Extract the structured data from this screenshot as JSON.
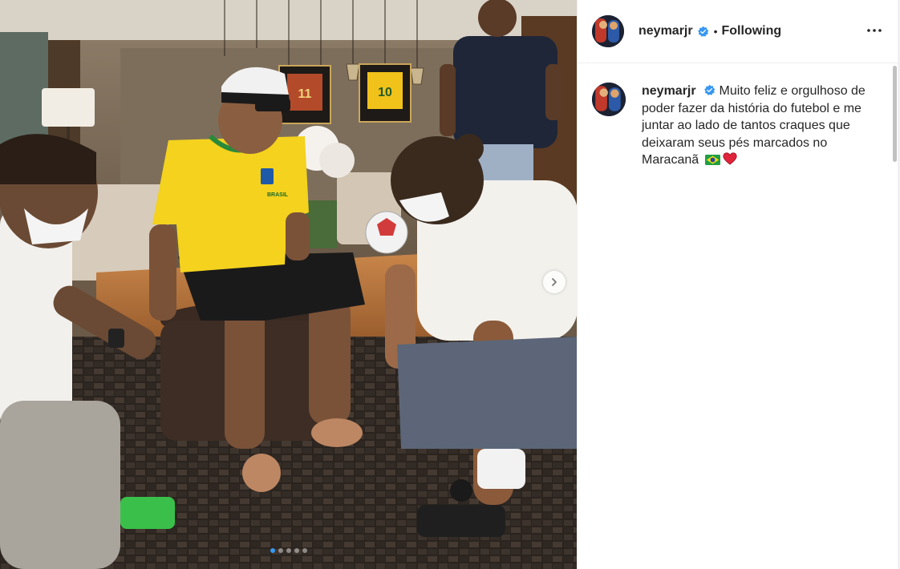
{
  "post": {
    "username": "neymarjr",
    "separator": "•",
    "follow_status": "Following",
    "caption_username": "neymarjr",
    "caption_text": "Muito feliz e orgulhoso de poder fazer da história do futebol e me juntar ao lado de tantos craques que deixaram seus pés marcados no Maracanã"
  },
  "carousel": {
    "slide_count": 5,
    "active_index": 0
  },
  "photo": {
    "jersey_text": "BRASIL",
    "frame_left_number": "11",
    "frame_right_number": "10"
  },
  "icons": {
    "verified": "verified-badge-icon",
    "more": "more-options-icon",
    "next": "chevron-right-icon",
    "flag": "brazil-flag-emoji",
    "heart": "red-heart-emoji"
  },
  "colors": {
    "accent": "#3897f0",
    "text": "#262626",
    "border": "#efefef"
  }
}
